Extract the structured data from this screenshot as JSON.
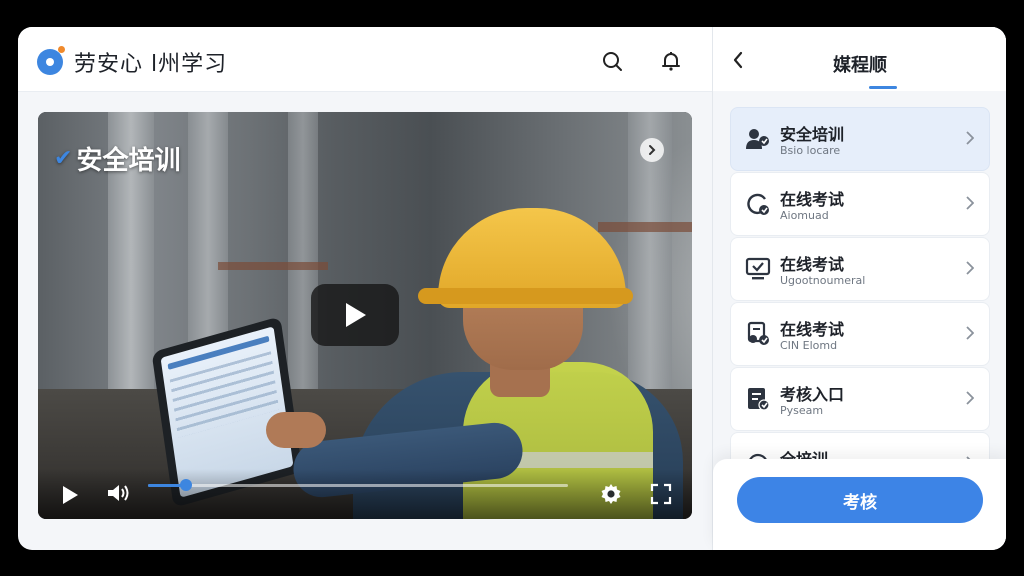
{
  "app": {
    "title": "劳安心 l州学习",
    "accent_color": "#3d86e0"
  },
  "header": {
    "search_icon": "search-icon",
    "bell_icon": "bell-icon"
  },
  "video": {
    "overlay_title": "安全培训",
    "progress_fraction": 0.09,
    "controls": [
      "play-icon",
      "volume-icon",
      "gear-icon",
      "fullscreen-icon"
    ]
  },
  "panel": {
    "title": "媒程顺",
    "items": [
      {
        "title": "安全培训",
        "subtitle": "Bsio locare",
        "icon": "user-group-icon",
        "active": true
      },
      {
        "title": "在线考试",
        "subtitle": "Aiomuad",
        "icon": "refresh-check-icon",
        "active": false
      },
      {
        "title": "在线考试",
        "subtitle": "Ugootnoumeral",
        "icon": "monitor-check-icon",
        "active": false
      },
      {
        "title": "在线考试",
        "subtitle": "CIN Elomd",
        "icon": "user-doc-icon",
        "active": false
      },
      {
        "title": "考核入口",
        "subtitle": "Pyseam",
        "icon": "document-check-icon",
        "active": false
      },
      {
        "title": "全培训",
        "subtitle": "",
        "icon": "certificate-icon",
        "active": false
      }
    ],
    "exam_button_label": "考核"
  }
}
